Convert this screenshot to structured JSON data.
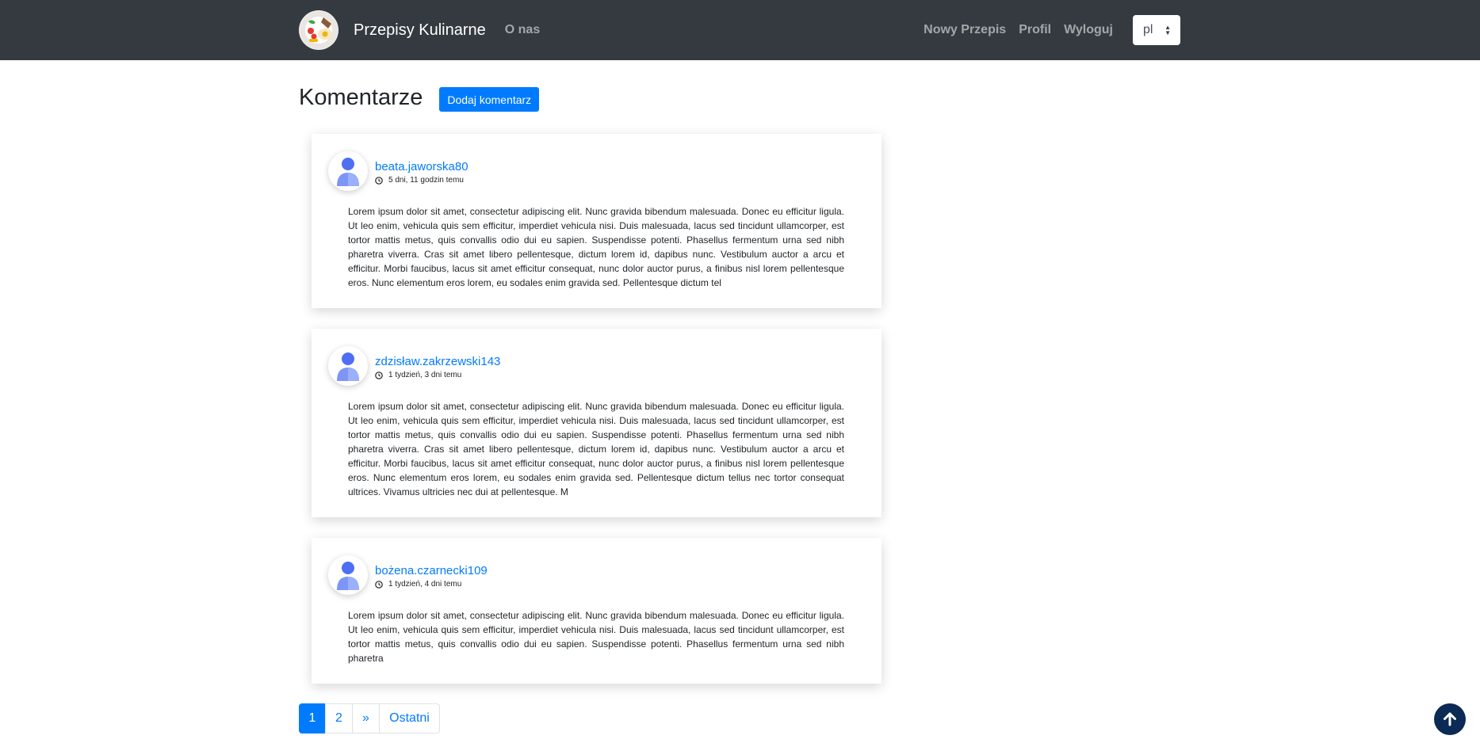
{
  "navbar": {
    "brand_name": "Przepisy Kulinarne",
    "about_link": "O nas",
    "new_recipe_link": "Nowy Przepis",
    "profile_link": "Profil",
    "logout_link": "Wyloguj",
    "language": "pl"
  },
  "page": {
    "title": "Komentarze",
    "add_comment_button": "Dodaj komentarz"
  },
  "comments": [
    {
      "author": "beata.jaworska80",
      "time_ago": "5 dni, 11 godzin temu",
      "text": "Lorem ipsum dolor sit amet, consectetur adipiscing elit. Nunc gravida bibendum malesuada. Donec eu efficitur ligula. Ut leo enim, vehicula quis sem efficitur, imperdiet vehicula nisi. Duis malesuada, lacus sed tincidunt ullamcorper, est tortor mattis metus, quis convallis odio dui eu sapien. Suspendisse potenti. Phasellus fermentum urna sed nibh pharetra viverra. Cras sit amet libero pellentesque, dictum lorem id, dapibus nunc. Vestibulum auctor a arcu et efficitur. Morbi faucibus, lacus sit amet efficitur consequat, nunc dolor auctor purus, a finibus nisl lorem pellentesque eros. Nunc elementum eros lorem, eu sodales enim gravida sed. Pellentesque dictum tel"
    },
    {
      "author": "zdzisław.zakrzewski143",
      "time_ago": "1 tydzień, 3 dni temu",
      "text": "Lorem ipsum dolor sit amet, consectetur adipiscing elit. Nunc gravida bibendum malesuada. Donec eu efficitur ligula. Ut leo enim, vehicula quis sem efficitur, imperdiet vehicula nisi. Duis malesuada, lacus sed tincidunt ullamcorper, est tortor mattis metus, quis convallis odio dui eu sapien. Suspendisse potenti. Phasellus fermentum urna sed nibh pharetra viverra. Cras sit amet libero pellentesque, dictum lorem id, dapibus nunc. Vestibulum auctor a arcu et efficitur. Morbi faucibus, lacus sit amet efficitur consequat, nunc dolor auctor purus, a finibus nisl lorem pellentesque eros. Nunc elementum eros lorem, eu sodales enim gravida sed. Pellentesque dictum tellus nec tortor consequat ultrices. Vivamus ultricies nec dui at pellentesque. M"
    },
    {
      "author": "bożena.czarnecki109",
      "time_ago": "1 tydzień, 4 dni temu",
      "text": "Lorem ipsum dolor sit amet, consectetur adipiscing elit. Nunc gravida bibendum malesuada. Donec eu efficitur ligula. Ut leo enim, vehicula quis sem efficitur, imperdiet vehicula nisi. Duis malesuada, lacus sed tincidunt ullamcorper, est tortor mattis metus, quis convallis odio dui eu sapien. Suspendisse potenti. Phasellus fermentum urna sed nibh pharetra"
    }
  ],
  "pagination": {
    "pages": [
      "1",
      "2"
    ],
    "current_page": "1",
    "next_label": "»",
    "last_label": "Ostatni"
  },
  "icons": {
    "clock": "clock-icon",
    "user": "user-icon",
    "scroll_top": "arrow-up-icon",
    "logo": "food-plate-icon"
  },
  "colors": {
    "navbar_bg": "#343a40",
    "primary": "#007bff",
    "scroll_top_bg": "#0b2a55"
  }
}
